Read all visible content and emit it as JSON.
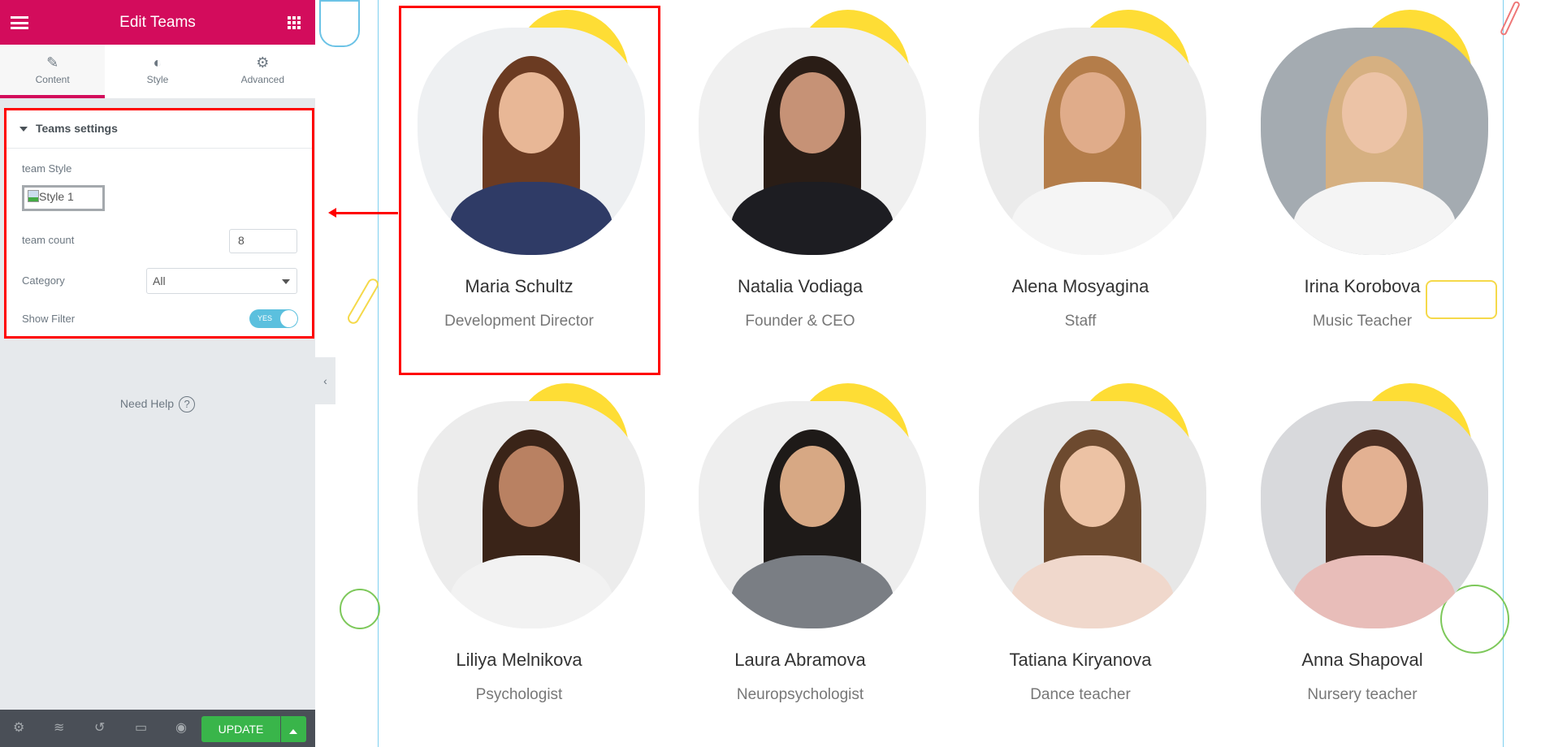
{
  "editor": {
    "title": "Edit Teams",
    "tabs": [
      {
        "label": "Content",
        "icon": "pencil-icon"
      },
      {
        "label": "Style",
        "icon": "half-circle-icon"
      },
      {
        "label": "Advanced",
        "icon": "gear-icon"
      }
    ],
    "section_title": "Teams settings",
    "fields": {
      "team_style_label": "team Style",
      "team_style_value": "Style 1",
      "team_count_label": "team count",
      "team_count_value": "8",
      "category_label": "Category",
      "category_value": "All",
      "show_filter_label": "Show Filter",
      "show_filter_value": "YES"
    },
    "need_help": "Need Help",
    "help_icon": "?",
    "update_label": "UPDATE",
    "accent": "#d30c5c",
    "update_color": "#39b54a"
  },
  "team": [
    {
      "name": "Maria Schultz",
      "role": "Development Director"
    },
    {
      "name": "Natalia Vodiaga",
      "role": "Founder & CEO"
    },
    {
      "name": "Alena Mosyagina",
      "role": "Staff"
    },
    {
      "name": "Irina Korobova",
      "role": "Music Teacher"
    },
    {
      "name": "Liliya Melnikova",
      "role": "Psychologist"
    },
    {
      "name": "Laura Abramova",
      "role": "Neuropsychologist"
    },
    {
      "name": "Tatiana Kiryanova",
      "role": "Dance teacher"
    },
    {
      "name": "Anna Shapoval",
      "role": "Nursery teacher"
    }
  ]
}
